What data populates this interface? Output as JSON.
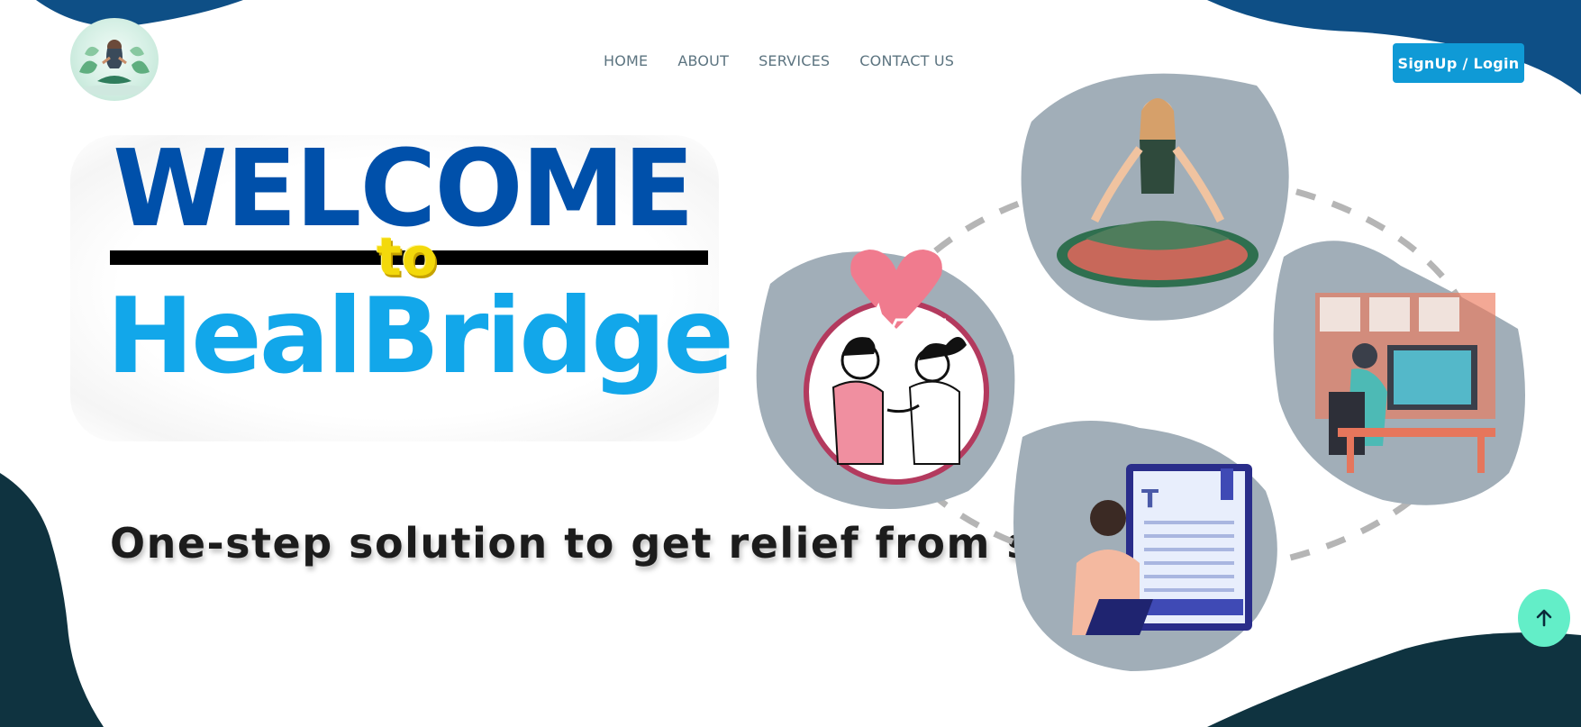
{
  "brand": {
    "logo_icon": "meditation-logo-icon"
  },
  "nav": {
    "items": [
      {
        "label": "HOME"
      },
      {
        "label": "ABOUT"
      },
      {
        "label": "SERVICES"
      },
      {
        "label": "CONTACT US"
      }
    ]
  },
  "auth": {
    "signup_label": "SignUp / Login"
  },
  "hero": {
    "welcome": "WELCOME",
    "to": "to",
    "brand_name": "HealBridge",
    "tagline": "One-step solution to get relief from stress."
  },
  "illustrations": [
    {
      "icon": "meditation-illustration-icon"
    },
    {
      "icon": "doctor-checkup-illustration-icon"
    },
    {
      "icon": "work-desk-illustration-icon"
    },
    {
      "icon": "online-reading-illustration-icon"
    }
  ],
  "scroll_top": {
    "icon": "arrow-up-icon"
  },
  "colors": {
    "accent": "#0f9ad6",
    "welcome_blue": "#0050aa",
    "brand_cyan": "#12a7ea",
    "wave_blue": "#0e4f86",
    "wave_dark": "#0f3340",
    "scroll_button": "#63eec8"
  }
}
